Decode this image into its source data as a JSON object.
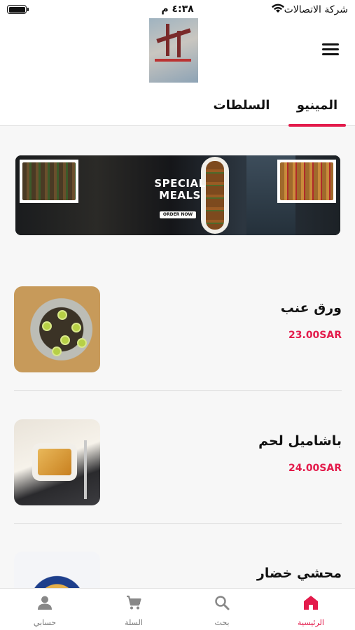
{
  "status_bar": {
    "carrier": "شركة الاتصالات",
    "time": "٤:٣٨ م"
  },
  "header": {
    "logo_icon": "restaurant-logo",
    "menu_icon": "hamburger-menu-icon"
  },
  "tabs": [
    {
      "label": "المينيو",
      "active": true
    },
    {
      "label": "السلطات",
      "active": false
    }
  ],
  "banner": {
    "title_line1": "SPECIAL",
    "title_line2": "MEALS",
    "cta": "ORDER NOW"
  },
  "products": [
    {
      "name": "ورق عنب",
      "price": "23.00SAR"
    },
    {
      "name": "باشاميل لحم",
      "price": "24.00SAR"
    },
    {
      "name": "محشي خضار",
      "price": ""
    }
  ],
  "bottom_nav": [
    {
      "label": "الرئيسية",
      "icon": "home-icon",
      "active": true
    },
    {
      "label": "بحث",
      "icon": "search-icon",
      "active": false
    },
    {
      "label": "السلة",
      "icon": "cart-icon",
      "active": false
    },
    {
      "label": "حسابي",
      "icon": "account-icon",
      "active": false
    }
  ],
  "colors": {
    "accent": "#e31b4b",
    "background": "#f7f7f7"
  }
}
